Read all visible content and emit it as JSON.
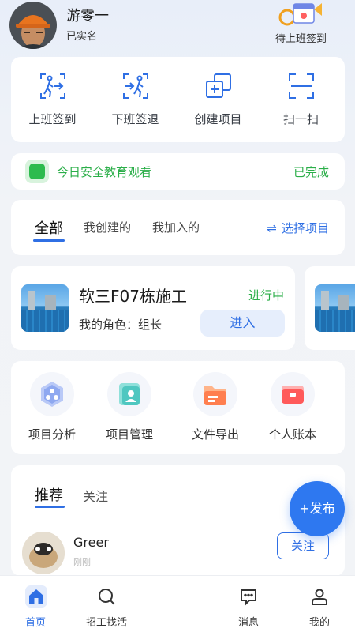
{
  "user": {
    "name": "游零一",
    "verified": "已实名",
    "checkin_status": "待上班签到"
  },
  "quick_actions": [
    {
      "label": "上班签到",
      "icon": "clock-in-icon"
    },
    {
      "label": "下班签退",
      "icon": "clock-out-icon"
    },
    {
      "label": "创建项目",
      "icon": "create-project-icon"
    },
    {
      "label": "扫一扫",
      "icon": "scan-icon"
    }
  ],
  "safety": {
    "title": "今日安全教育观看",
    "status": "已完成"
  },
  "filters": {
    "tabs": [
      "全部",
      "我创建的",
      "我加入的"
    ],
    "active": "全部",
    "select_label": "选择项目"
  },
  "project": {
    "name": "软三F07栋施工",
    "status": "进行中",
    "role": "我的角色：组长",
    "enter_label": "进入"
  },
  "tools": [
    {
      "label": "项目分析",
      "icon": "analysis-icon"
    },
    {
      "label": "项目管理",
      "icon": "management-icon"
    },
    {
      "label": "文件导出",
      "icon": "folder-export-icon"
    },
    {
      "label": "个人账本",
      "icon": "wallet-icon"
    }
  ],
  "feed": {
    "tabs": [
      "推荐",
      "关注"
    ],
    "active": "推荐",
    "post": {
      "author": "Greer",
      "sub": "刚刚",
      "follow_label": "关注"
    }
  },
  "publish_label": "+发布",
  "bottom_nav": [
    {
      "label": "首页",
      "icon": "home-icon",
      "active": true
    },
    {
      "label": "招工找活",
      "icon": "search-icon",
      "active": false
    },
    {
      "label": "消息",
      "icon": "message-icon",
      "active": false
    },
    {
      "label": "我的",
      "icon": "profile-icon",
      "active": false
    }
  ],
  "colors": {
    "accent": "#2f6fe4",
    "success": "#2aae48",
    "publish": "#2e78f0"
  }
}
